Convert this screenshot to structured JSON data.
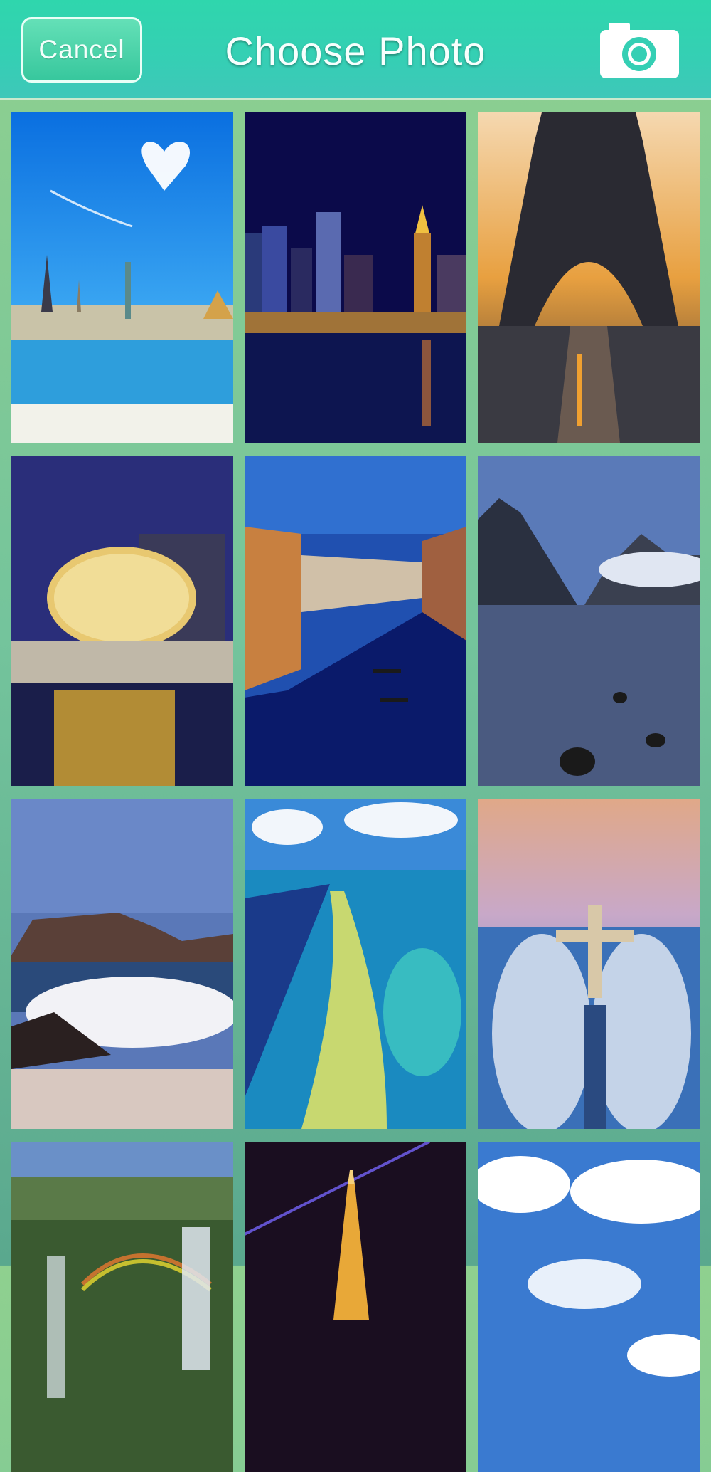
{
  "header": {
    "cancel_label": "Cancel",
    "title": "Choose Photo",
    "camera_icon": "camera-icon"
  },
  "colors": {
    "header_bg": "#35cfb4",
    "background": "#7cc89a",
    "text": "#ffffff"
  },
  "photos": [
    {
      "name": "photo-world-landmarks-beach"
    },
    {
      "name": "photo-city-skyline-night"
    },
    {
      "name": "photo-eiffel-tower-street"
    },
    {
      "name": "photo-geodesic-dome-night"
    },
    {
      "name": "photo-venice-grand-canal"
    },
    {
      "name": "photo-mountain-lake"
    },
    {
      "name": "photo-table-mountain-waves"
    },
    {
      "name": "photo-coral-reef-aerial"
    },
    {
      "name": "photo-christ-redeemer-aerial"
    },
    {
      "name": "photo-waterfall-rainbow"
    },
    {
      "name": "photo-eiffel-tower-night"
    },
    {
      "name": "photo-clouds-sky"
    }
  ]
}
